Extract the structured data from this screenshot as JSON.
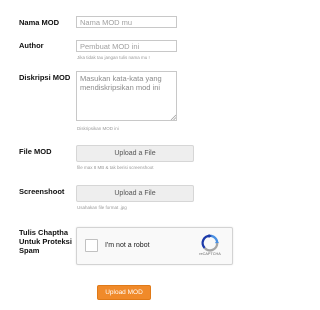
{
  "form": {
    "nama_mod": {
      "label": "Nama MOD",
      "placeholder": "Nama MOD mu"
    },
    "author": {
      "label": "Author",
      "placeholder": "Pembuat MOD ini",
      "hint": "Jika tidak tau jangan tulis nama mu !"
    },
    "deskripsi": {
      "label": "Diskripsi MOD",
      "placeholder": "Masukan kata-kata yang mendiskripsikan mod ini",
      "hint": "Diskripsikan MOD ini"
    },
    "file_mod": {
      "label": "File MOD",
      "button_label": "Upload a File",
      "hint": "file max 8 MB & tak berisi screenshoot"
    },
    "screenshoot": {
      "label": "Screenshoot",
      "button_label": "Upload a File",
      "hint": "Usahakan file format .jpg"
    },
    "captcha": {
      "label": "Tulis Chaptha Untuk Proteksi Spam",
      "checkbox_text": "I'm not a robot",
      "brand": "reCAPTCHA",
      "logo_icon": "recaptcha-icon"
    },
    "submit_label": "Upload MOD"
  },
  "colors": {
    "submit_bg": "#f08a2a",
    "recaptcha_blue": "#4a90e2",
    "recaptcha_dark_blue": "#1c3aa9",
    "recaptcha_gray": "#a6a6a6"
  }
}
